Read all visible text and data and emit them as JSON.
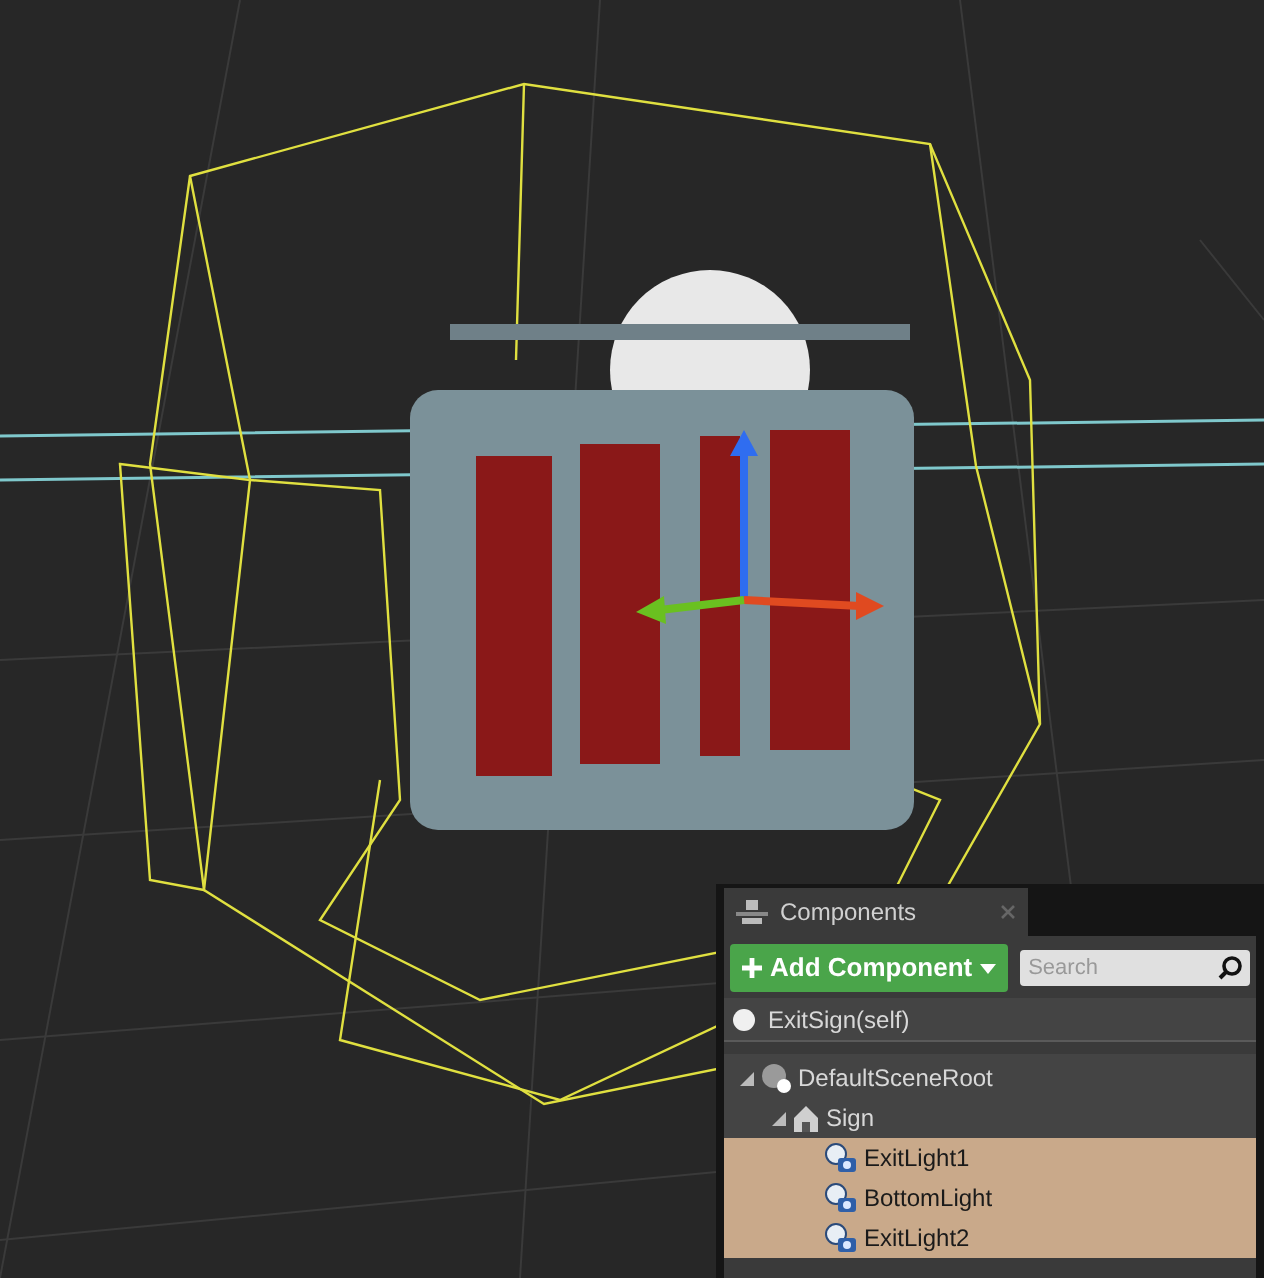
{
  "panel": {
    "tab": {
      "label": "Components",
      "selected": true
    },
    "add_button": {
      "label": "Add Component"
    },
    "search": {
      "placeholder": "Search"
    },
    "self_item": {
      "label": "ExitSign(self)"
    },
    "tree": [
      {
        "label": "DefaultSceneRoot",
        "kind": "scene-root",
        "expanded": true,
        "selected": false,
        "children": [
          {
            "label": "Sign",
            "kind": "mesh",
            "expanded": true,
            "selected": false,
            "children": [
              {
                "label": "ExitLight1",
                "kind": "light",
                "selected": true
              },
              {
                "label": "BottomLight",
                "kind": "light",
                "selected": true
              },
              {
                "label": "ExitLight2",
                "kind": "light",
                "selected": true
              }
            ]
          }
        ]
      }
    ]
  }
}
